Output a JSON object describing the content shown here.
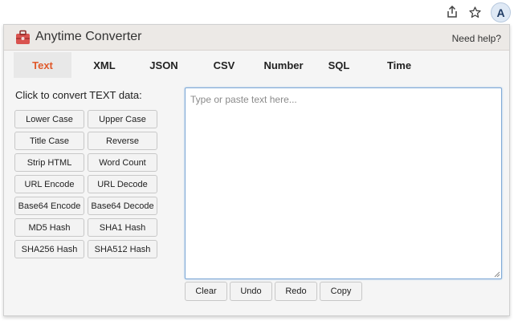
{
  "browser": {
    "avatar_letter": "A"
  },
  "header": {
    "title": "Anytime Converter",
    "help": "Need help?"
  },
  "tabs": [
    {
      "label": "Text",
      "active": true
    },
    {
      "label": "XML"
    },
    {
      "label": "JSON"
    },
    {
      "label": "CSV"
    },
    {
      "label": "Number"
    },
    {
      "label": "SQL"
    },
    {
      "label": "Time"
    }
  ],
  "main": {
    "section_label": "Click to convert TEXT data:",
    "operations": [
      "Lower Case",
      "Upper Case",
      "Title Case",
      "Reverse",
      "Strip HTML",
      "Word Count",
      "URL Encode",
      "URL Decode",
      "Base64 Encode",
      "Base64 Decode",
      "MD5 Hash",
      "SHA1 Hash",
      "SHA256 Hash",
      "SHA512 Hash"
    ],
    "input_placeholder": "Type or paste text here...",
    "input_value": "",
    "actions": [
      "Clear",
      "Undo",
      "Redo",
      "Copy"
    ]
  },
  "colors": {
    "accent": "#e0592a",
    "focus_border": "#7fa9d6"
  }
}
